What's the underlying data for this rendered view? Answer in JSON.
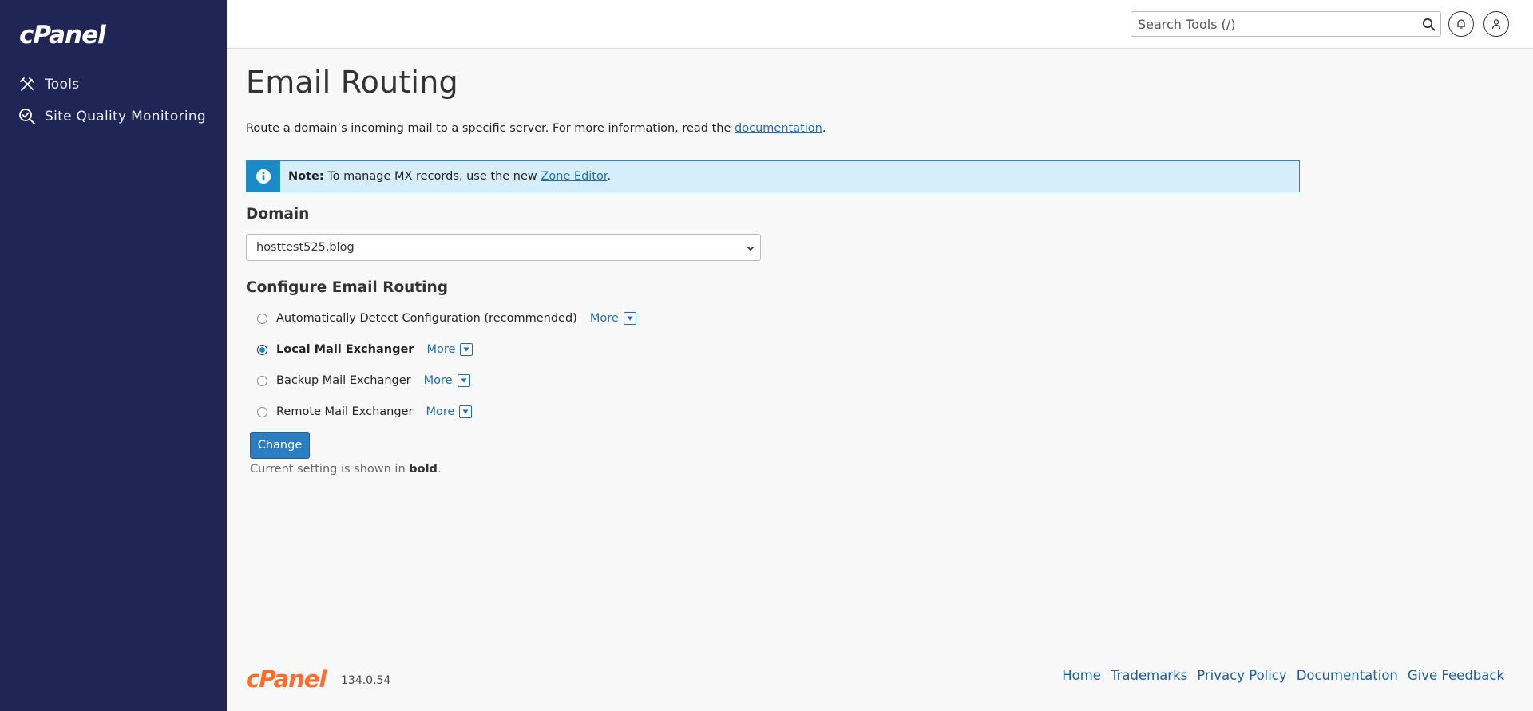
{
  "sidebar": {
    "logo": "cPanel",
    "items": [
      {
        "label": "Tools",
        "icon": "tools-icon"
      },
      {
        "label": "Site Quality Monitoring",
        "icon": "site-quality-icon"
      }
    ]
  },
  "header": {
    "search_placeholder": "Search Tools (/)",
    "notifications_icon": "bell-icon",
    "user_icon": "user-icon"
  },
  "main": {
    "title": "Email Routing",
    "description_prefix": "Route a domain’s incoming mail to a specific server. For more information, read the ",
    "description_link": "documentation",
    "description_suffix": ".",
    "note": {
      "label": "Note:",
      "text": " To manage MX records, use the new ",
      "link": "Zone Editor",
      "suffix": "."
    },
    "domain": {
      "heading": "Domain",
      "selected": "hosttest525.blog"
    },
    "routing": {
      "heading": "Configure Email Routing",
      "options": [
        {
          "label": "Automatically Detect Configuration (recommended)",
          "checked": false,
          "current": false
        },
        {
          "label": "Local Mail Exchanger",
          "checked": true,
          "current": true
        },
        {
          "label": "Backup Mail Exchanger",
          "checked": false,
          "current": false
        },
        {
          "label": "Remote Mail Exchanger",
          "checked": false,
          "current": false
        }
      ],
      "more_label": "More"
    },
    "change_button": "Change",
    "help_prefix": "Current setting is shown in ",
    "help_bold": "bold",
    "help_suffix": "."
  },
  "footer": {
    "logo": "cPanel",
    "version": "134.0.54",
    "links": [
      "Home",
      "Trademarks",
      "Privacy Policy",
      "Documentation",
      "Give Feedback"
    ]
  },
  "colors": {
    "sidebar_bg": "#1f2554",
    "accent": "#1a8bc7",
    "link": "#1b6fb8",
    "brand_orange": "#ff6c2c"
  }
}
